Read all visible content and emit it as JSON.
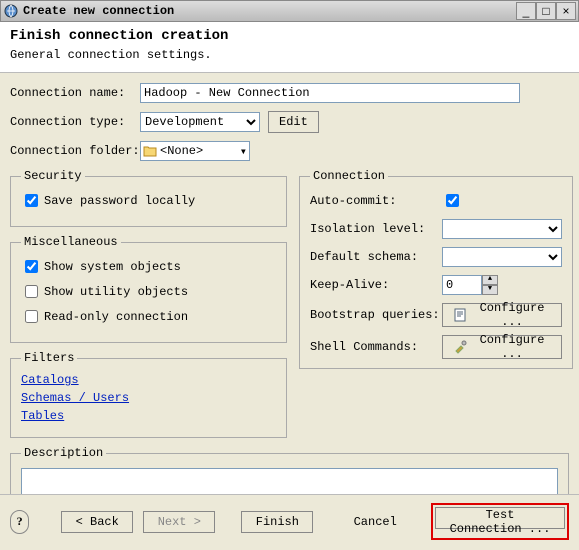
{
  "window": {
    "title": "Create new connection"
  },
  "header": {
    "title": "Finish connection creation",
    "subtitle": "General connection settings."
  },
  "form": {
    "name_label": "Connection name:",
    "name_value": "Hadoop - New Connection",
    "type_label": "Connection type:",
    "type_value": "Development",
    "edit_btn": "Edit",
    "folder_label": "Connection folder:",
    "folder_value": "<None>"
  },
  "security": {
    "legend": "Security",
    "save_pwd": "Save password locally",
    "save_pwd_checked": true
  },
  "misc": {
    "legend": "Miscellaneous",
    "show_system": "Show system objects",
    "show_system_checked": true,
    "show_utility": "Show utility objects",
    "show_utility_checked": false,
    "readonly": "Read-only connection",
    "readonly_checked": false
  },
  "filters": {
    "legend": "Filters",
    "catalogs": "Catalogs",
    "schemas": "Schemas / Users",
    "tables": "Tables"
  },
  "conn": {
    "legend": "Connection",
    "auto_commit": "Auto-commit:",
    "auto_commit_checked": true,
    "isolation": "Isolation level:",
    "default_schema": "Default schema:",
    "keep_alive": "Keep-Alive:",
    "keep_alive_value": "0",
    "bootstrap": "Bootstrap queries:",
    "shell": "Shell Commands:",
    "configure": "Configure ..."
  },
  "desc": {
    "legend": "Description"
  },
  "footer": {
    "back": "< Back",
    "next": "Next >",
    "finish": "Finish",
    "cancel": "Cancel",
    "test": "Test Connection ..."
  }
}
